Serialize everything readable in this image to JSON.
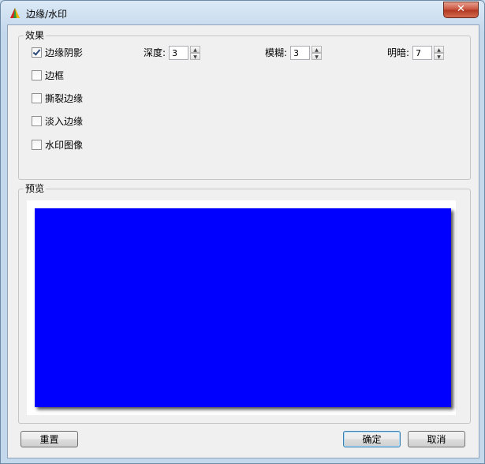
{
  "window": {
    "title": "边缘/水印",
    "close_icon": "close-icon",
    "app_icon": "app-icon"
  },
  "effects": {
    "group_label": "效果",
    "options": [
      {
        "label": "边缘阴影",
        "checked": true
      },
      {
        "label": "边框",
        "checked": false
      },
      {
        "label": "撕裂边缘",
        "checked": false
      },
      {
        "label": "淡入边缘",
        "checked": false
      },
      {
        "label": "水印图像",
        "checked": false
      }
    ],
    "depth": {
      "label": "深度:",
      "value": "3"
    },
    "blur": {
      "label": "模糊:",
      "value": "3"
    },
    "brightness": {
      "label": "明暗:",
      "value": "7"
    }
  },
  "preview": {
    "group_label": "预览",
    "shape_color": "#0000ff"
  },
  "buttons": {
    "reset": "重置",
    "ok": "确定",
    "cancel": "取消"
  }
}
